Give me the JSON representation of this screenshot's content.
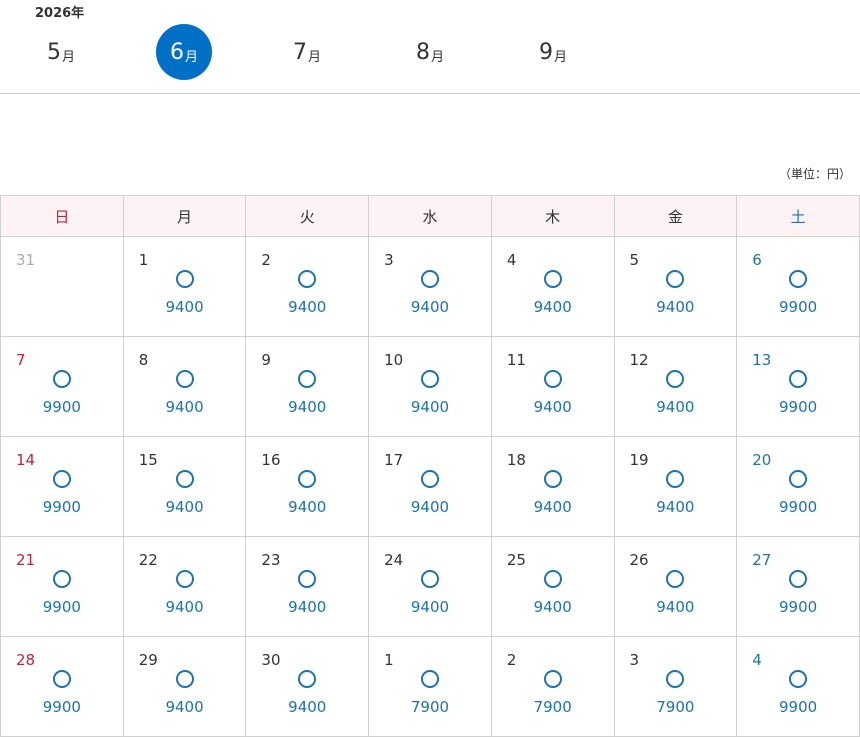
{
  "year": "2026年",
  "months": [
    {
      "num": "5",
      "unit": "月",
      "active": false
    },
    {
      "num": "6",
      "unit": "月",
      "active": true
    },
    {
      "num": "7",
      "unit": "月",
      "active": false
    },
    {
      "num": "8",
      "unit": "月",
      "active": false
    },
    {
      "num": "9",
      "unit": "月",
      "active": false
    }
  ],
  "unit_note": "（単位：円）",
  "weekdays": [
    "日",
    "月",
    "火",
    "水",
    "木",
    "金",
    "土"
  ],
  "weeks": [
    [
      {
        "day": "31",
        "other": true
      },
      {
        "day": "1",
        "mark": "○",
        "price": "9400"
      },
      {
        "day": "2",
        "mark": "○",
        "price": "9400"
      },
      {
        "day": "3",
        "mark": "○",
        "price": "9400"
      },
      {
        "day": "4",
        "mark": "○",
        "price": "9400"
      },
      {
        "day": "5",
        "mark": "○",
        "price": "9400"
      },
      {
        "day": "6",
        "mark": "○",
        "price": "9900"
      }
    ],
    [
      {
        "day": "7",
        "mark": "○",
        "price": "9900"
      },
      {
        "day": "8",
        "mark": "○",
        "price": "9400"
      },
      {
        "day": "9",
        "mark": "○",
        "price": "9400"
      },
      {
        "day": "10",
        "mark": "○",
        "price": "9400"
      },
      {
        "day": "11",
        "mark": "○",
        "price": "9400"
      },
      {
        "day": "12",
        "mark": "○",
        "price": "9400"
      },
      {
        "day": "13",
        "mark": "○",
        "price": "9900"
      }
    ],
    [
      {
        "day": "14",
        "mark": "○",
        "price": "9900"
      },
      {
        "day": "15",
        "mark": "○",
        "price": "9400"
      },
      {
        "day": "16",
        "mark": "○",
        "price": "9400"
      },
      {
        "day": "17",
        "mark": "○",
        "price": "9400"
      },
      {
        "day": "18",
        "mark": "○",
        "price": "9400"
      },
      {
        "day": "19",
        "mark": "○",
        "price": "9400"
      },
      {
        "day": "20",
        "mark": "○",
        "price": "9900"
      }
    ],
    [
      {
        "day": "21",
        "mark": "○",
        "price": "9900"
      },
      {
        "day": "22",
        "mark": "○",
        "price": "9400"
      },
      {
        "day": "23",
        "mark": "○",
        "price": "9400"
      },
      {
        "day": "24",
        "mark": "○",
        "price": "9400"
      },
      {
        "day": "25",
        "mark": "○",
        "price": "9400"
      },
      {
        "day": "26",
        "mark": "○",
        "price": "9400"
      },
      {
        "day": "27",
        "mark": "○",
        "price": "9900"
      }
    ],
    [
      {
        "day": "28",
        "mark": "○",
        "price": "9900"
      },
      {
        "day": "29",
        "mark": "○",
        "price": "9400"
      },
      {
        "day": "30",
        "mark": "○",
        "price": "9400"
      },
      {
        "day": "1",
        "mark": "○",
        "price": "7900"
      },
      {
        "day": "2",
        "mark": "○",
        "price": "7900"
      },
      {
        "day": "3",
        "mark": "○",
        "price": "7900"
      },
      {
        "day": "4",
        "mark": "○",
        "price": "9900"
      }
    ]
  ],
  "colors": {
    "accent": "#0070c6",
    "sunday": "#c0243a",
    "saturday": "#1d72b2",
    "header_bg": "#fdf2f4",
    "outside_month": "#aaaaaa"
  }
}
